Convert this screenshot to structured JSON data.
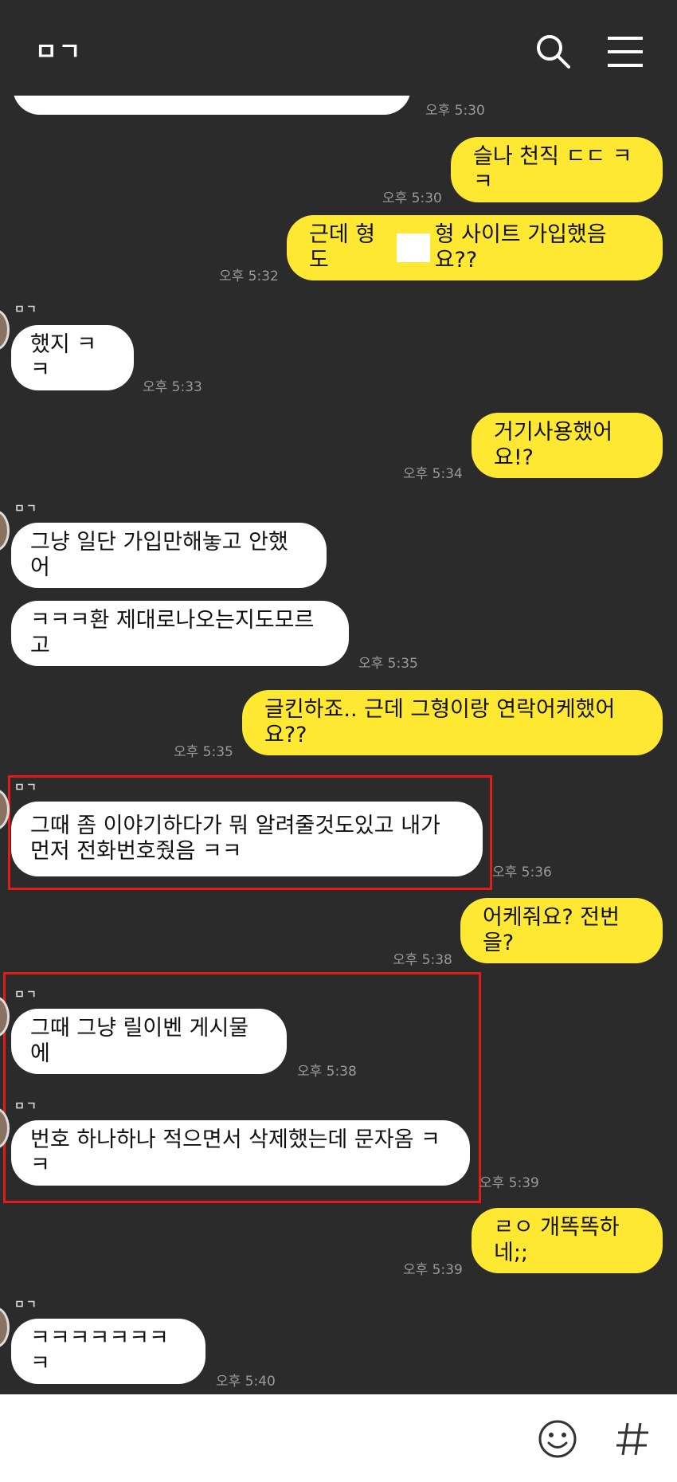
{
  "header": {
    "title": "ㅁㄱ"
  },
  "messages": [
    {
      "time": "오후 5:30"
    },
    {
      "text": "슬나 천직 ㄷㄷ ㅋㅋ",
      "time": "오후 5:30"
    },
    {
      "text_a": "근데 형도",
      "text_b": "형 사이트 가입했음요??",
      "time": "오후 5:32"
    },
    {
      "sender": "ㅁㄱ",
      "text": "했지 ㅋㅋ",
      "time": "오후 5:33"
    },
    {
      "text": "거기사용했어요!?",
      "time": "오후 5:34"
    },
    {
      "sender": "ㅁㄱ",
      "text": "그냥 일단 가입만해놓고 안했어"
    },
    {
      "text": "ㅋㅋㅋ환 제대로나오는지도모르고",
      "time": "오후 5:35"
    },
    {
      "text": "글킨하죠.. 근데 그형이랑 연락어케했어요??",
      "time": "오후 5:35"
    },
    {
      "sender": "ㅁㄱ",
      "line1": "그때 좀 이야기하다가 뭐 알려줄것도있고 내가",
      "line2": "먼저 전화번호줬음 ㅋㅋ",
      "time": "오후 5:36"
    },
    {
      "text": "어케줘요? 전번을?",
      "time": "오후 5:38"
    },
    {
      "sender": "ㅁㄱ",
      "text": "그때 그냥 릴이벤 게시물에",
      "time": "오후 5:38"
    },
    {
      "sender": "ㅁㄱ",
      "text": "번호 하나하나 적으면서 삭제했는데 문자옴 ㅋㅋ",
      "time": "오후 5:39"
    },
    {
      "text": "ㄹㅇ 개똑똑하네;;",
      "time": "오후 5:39"
    },
    {
      "sender": "ㅁㄱ",
      "text": "ㅋㅋㅋㅋㅋㅋㅋㅋ",
      "time": "오후 5:40"
    }
  ]
}
